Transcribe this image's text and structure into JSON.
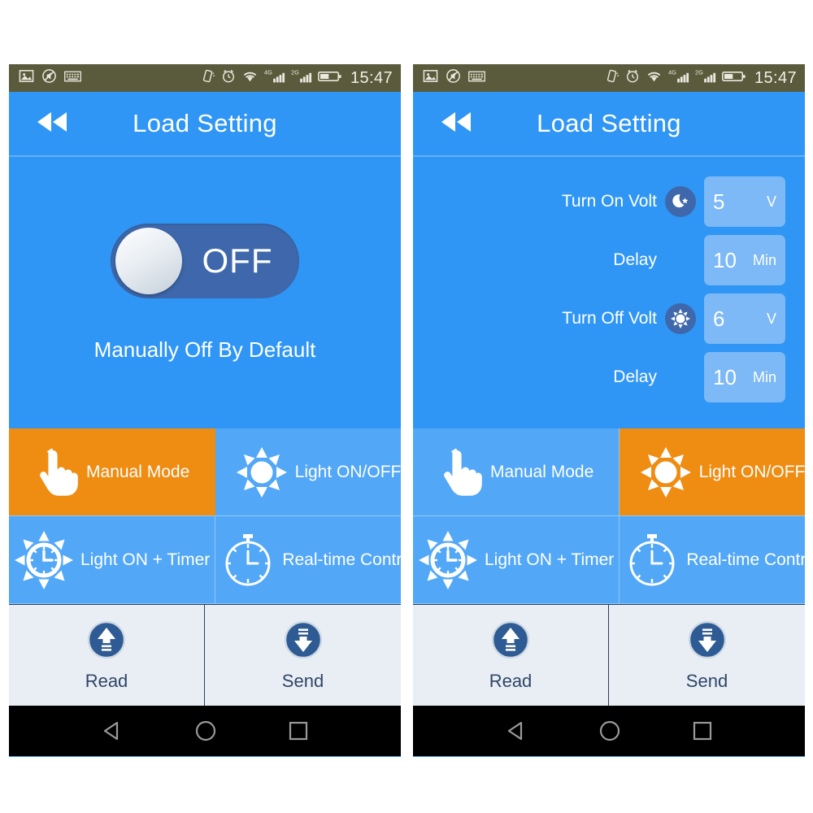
{
  "statusbar": {
    "left_icons": [
      "image-icon",
      "mute-icon",
      "keyboard-icon"
    ],
    "right_icons": [
      "vibrate-icon",
      "alarm-icon",
      "wifi-icon",
      "signal-4g-icon",
      "signal-2g-icon",
      "battery-icon"
    ],
    "signal_4g_label": "4G",
    "signal_2g_label": "2G",
    "time": "15:47"
  },
  "appbar": {
    "back_icon": "rewind-back-icon",
    "title": "Load Setting"
  },
  "left_panel": {
    "toggle": {
      "state_label": "OFF",
      "caption": "Manually Off By Default"
    },
    "modes": [
      {
        "label": "Manual Mode",
        "icon": "hand-pointer-icon",
        "active": true
      },
      {
        "label": "Light ON/OFF",
        "icon": "sun-icon",
        "active": false
      },
      {
        "label": "Light ON + Timer",
        "icon": "sun-clock-icon",
        "active": false
      },
      {
        "label": "Real-time Control",
        "icon": "stopwatch-icon",
        "active": false
      }
    ],
    "footer": [
      {
        "label": "Read",
        "icon": "upload-arrow-icon"
      },
      {
        "label": "Send",
        "icon": "download-arrow-icon"
      }
    ]
  },
  "right_panel": {
    "settings": [
      {
        "label": "Turn On Volt",
        "icon": "moon-star-icon",
        "value": "5",
        "unit": "V"
      },
      {
        "label": "Delay",
        "icon": "none",
        "value": "10",
        "unit": "Min"
      },
      {
        "label": "Turn Off Volt",
        "icon": "sun-icon",
        "value": "6",
        "unit": "V"
      },
      {
        "label": "Delay",
        "icon": "none",
        "value": "10",
        "unit": "Min"
      }
    ],
    "modes": [
      {
        "label": "Manual Mode",
        "icon": "hand-pointer-icon",
        "active": false
      },
      {
        "label": "Light ON/OFF",
        "icon": "sun-icon",
        "active": true
      },
      {
        "label": "Light ON + Timer",
        "icon": "sun-clock-icon",
        "active": false
      },
      {
        "label": "Real-time Control",
        "icon": "stopwatch-icon",
        "active": false
      }
    ],
    "footer": [
      {
        "label": "Read",
        "icon": "upload-arrow-icon"
      },
      {
        "label": "Send",
        "icon": "download-arrow-icon"
      }
    ]
  },
  "navbar": {
    "items": [
      "back-triangle-icon",
      "home-circle-icon",
      "recents-square-icon"
    ]
  },
  "colors": {
    "app_blue": "#2f96f5",
    "mode_blue": "#52a7f7",
    "accent_orange": "#ef8c12",
    "footer_bg": "#e9eef4",
    "statusbar_bg": "#5a5a3c",
    "value_box": "#7cb9f6",
    "dark_blue": "#3e68ab"
  }
}
